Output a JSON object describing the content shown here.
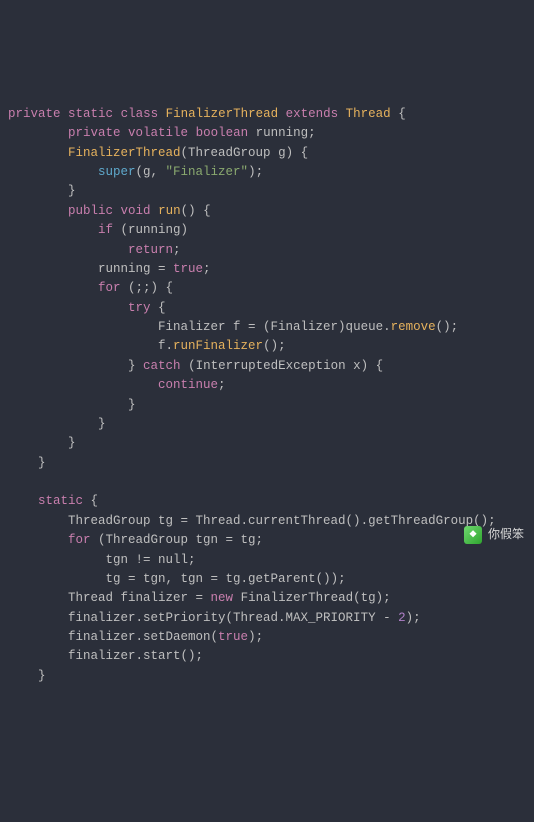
{
  "code": {
    "l1": {
      "kw_private": "private",
      "kw_static": "static",
      "kw_class": "class",
      "name": "FinalizerThread",
      "kw_extends": "extends",
      "parent": "Thread",
      "brace": " {"
    },
    "l2": {
      "kw_private": "private",
      "kw_volatile": "volatile",
      "kw_boolean": "boolean",
      "var": " running;"
    },
    "l3": {
      "ctor": "FinalizerThread",
      "sig": "(ThreadGroup g) {"
    },
    "l4": {
      "super": "super",
      "args": "(g, ",
      "str": "\"Finalizer\"",
      "close": ");"
    },
    "l5": {
      "brace": "}"
    },
    "l6": {
      "kw_public": "public",
      "kw_void": "void",
      "fn": "run",
      "sig": "() {"
    },
    "l7": {
      "kw_if": "if",
      "cond": " (running)"
    },
    "l8": {
      "kw_return": "return",
      "semi": ";"
    },
    "l9": {
      "stmt": "running = ",
      "true": "true",
      "semi": ";"
    },
    "l10": {
      "kw_for": "for",
      "cond": " (;;) {"
    },
    "l11": {
      "kw_try": "try",
      "brace": " {"
    },
    "l12": {
      "stmt_a": "Finalizer f = (Finalizer)queue.",
      "m": "remove",
      "tail": "();"
    },
    "l13": {
      "stmt_a": "f.",
      "m": "runFinalizer",
      "tail": "();"
    },
    "l14": {
      "brace_close": "} ",
      "kw_catch": "catch",
      "cond": " (InterruptedException x) {"
    },
    "l15": {
      "kw_continue": "continue",
      "semi": ";"
    },
    "l16": {
      "brace": "}"
    },
    "l17": {
      "brace": "}"
    },
    "l18": {
      "brace": "}"
    },
    "l19": {
      "brace": "}"
    },
    "l20": {
      "empty": ""
    },
    "l21": {
      "kw_static": "static",
      "brace": " {"
    },
    "l22": {
      "stmt": "ThreadGroup tg = Thread.currentThread().getThreadGroup();"
    },
    "l23": {
      "kw_for": "for",
      "cond": " (ThreadGroup tgn = tg;"
    },
    "l24": {
      "stmt": "tgn != null;"
    },
    "l25": {
      "stmt": "tg = tgn, tgn = tg.getParent());"
    },
    "l26": {
      "stmt_a": "Thread finalizer = ",
      "kw_new": "new",
      "stmt_b": " FinalizerThread(tg);"
    },
    "l27": {
      "stmt_a": "finalizer.setPriority(Thread.MAX_PRIORITY - ",
      "num": "2",
      "tail": ");"
    },
    "l28": {
      "stmt_a": "finalizer.setDaemon(",
      "true": "true",
      "tail": ");"
    },
    "l29": {
      "stmt": "finalizer.start();"
    },
    "l30": {
      "brace": "}"
    }
  },
  "watermark": {
    "icon_text": "❖",
    "label": "你假笨"
  }
}
